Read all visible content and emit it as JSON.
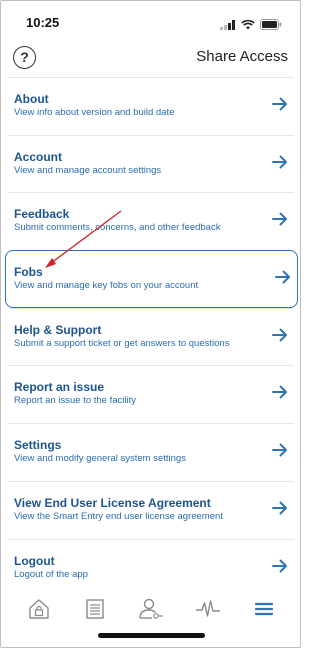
{
  "status_bar": {
    "time": "10:25"
  },
  "header": {
    "title": "Share Access"
  },
  "menu": {
    "items": [
      {
        "title": "About",
        "description": "View info about version and build date"
      },
      {
        "title": "Account",
        "description": "View and manage account settings"
      },
      {
        "title": "Feedback",
        "description": "Submit comments, concerns, and other feedback"
      },
      {
        "title": "Fobs",
        "description": "View and manage key fobs on your account"
      },
      {
        "title": "Help & Support",
        "description": "Submit a support ticket or get answers to questions"
      },
      {
        "title": "Report an issue",
        "description": "Report an issue to the facility"
      },
      {
        "title": "Settings",
        "description": "View and modify general system settings"
      },
      {
        "title": "View End User License Agreement",
        "description": "View the Smart Entry end user license agreement"
      },
      {
        "title": "Logout",
        "description": "Logout of the app"
      }
    ]
  },
  "tab_bar": {
    "icons": [
      "lock-home-icon",
      "document-icon",
      "user-key-icon",
      "activity-icon",
      "menu-icon"
    ]
  },
  "colors": {
    "accent": "#2f73b6",
    "title": "#1d5590",
    "annotation": "#d32020"
  }
}
